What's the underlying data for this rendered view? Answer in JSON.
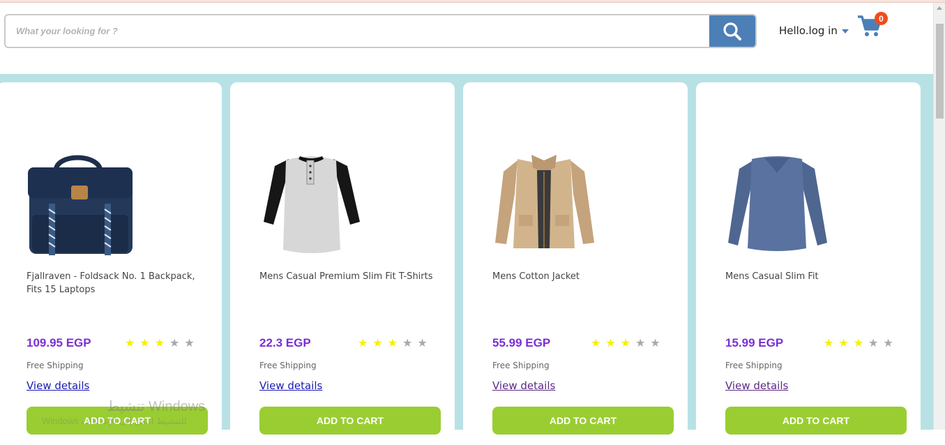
{
  "header": {
    "search": {
      "placeholder": "What your looking for ?"
    },
    "login_label": "Hello.log in",
    "cart_count": "0"
  },
  "products": [
    {
      "title": "Fjallraven - Foldsack No. 1 Backpack, Fits 15 Laptops",
      "price": "109.95 EGP",
      "rating": 3,
      "shipping": "Free Shipping",
      "details_label": "View details",
      "add_label": "ADD TO CART",
      "image": "backpack"
    },
    {
      "title": "Mens Casual Premium Slim Fit T-Shirts",
      "price": "22.3 EGP",
      "rating": 3,
      "shipping": "Free Shipping",
      "details_label": "View details",
      "add_label": "ADD TO CART",
      "image": "raglan-shirt"
    },
    {
      "title": "Mens Cotton Jacket",
      "price": "55.99 EGP",
      "rating": 3,
      "shipping": "Free Shipping",
      "details_label": "View details",
      "add_label": "ADD TO CART",
      "image": "cotton-jacket"
    },
    {
      "title": "Mens Casual Slim Fit",
      "price": "15.99 EGP",
      "rating": 3,
      "shipping": "Free Shipping",
      "details_label": "View details",
      "add_label": "ADD TO CART",
      "image": "long-sleeve-shirt"
    }
  ],
  "watermark": {
    "line1": "تنشيط Windows",
    "line2": "Windows للتنشيط انتقل إلى الإعدادات"
  },
  "colors": {
    "accent": "#4b7fb6",
    "band": "#b8e1e6",
    "price": "#7b2fd6",
    "button": "#9acd32",
    "badge": "#f24b1a"
  }
}
